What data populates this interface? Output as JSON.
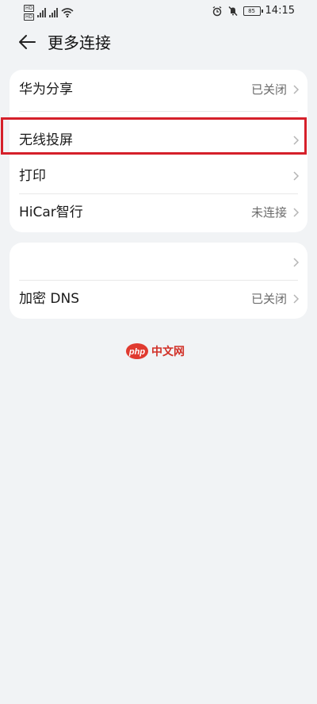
{
  "status_bar": {
    "sim1": "HD",
    "sim2": "HD",
    "time": "14:15",
    "battery": "85"
  },
  "header": {
    "title": "更多连接"
  },
  "group1": [
    {
      "label": "华为分享",
      "value": "已关闭"
    },
    {
      "label": "无线投屏",
      "value": ""
    },
    {
      "label": "打印",
      "value": ""
    },
    {
      "label": "HiCar智行",
      "value": "未连接"
    }
  ],
  "group2": [
    {
      "label": "",
      "value": ""
    },
    {
      "label": "加密 DNS",
      "value": "已关闭"
    }
  ],
  "highlight_color": "#d5202a",
  "watermark": {
    "brand": "php",
    "text": "中文网"
  }
}
